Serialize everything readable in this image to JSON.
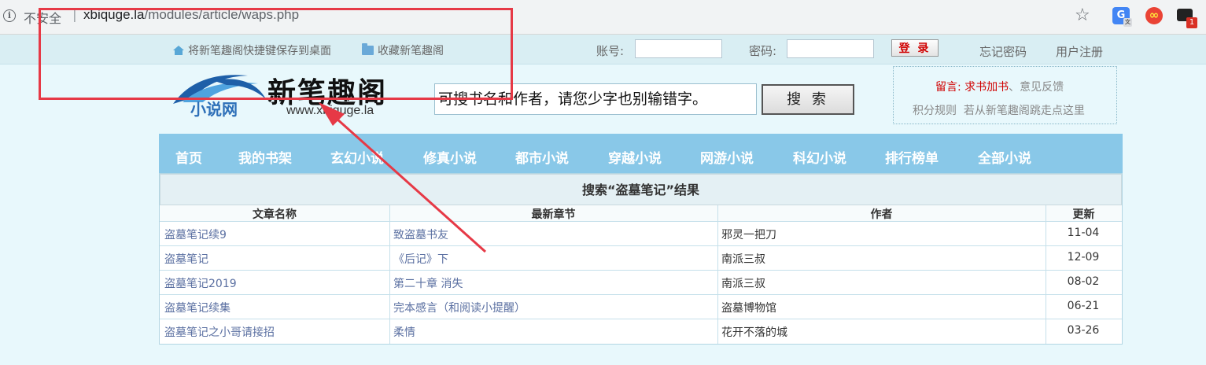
{
  "browser": {
    "insecure_label": "不安全",
    "separator": "|",
    "url_host": "xbiquge.la",
    "url_path": "/modules/article/waps.php",
    "extension_badge": "1"
  },
  "topbar": {
    "save_shortcut": "将新笔趣阁快捷键保存到桌面",
    "bookmark": "收藏新笔趣阁",
    "account_label": "账号:",
    "password_label": "密码:",
    "login_button": "登 录",
    "forgot_password": "忘记密码",
    "register": "用户注册"
  },
  "logo": {
    "title": "新笔趣阁",
    "subtitle": "小说网",
    "url": "www.xbiquge.la"
  },
  "search": {
    "placeholder": "可搜书名和作者，请您少字也别输错字。",
    "button": "搜 索"
  },
  "notice": {
    "prefix": "留言:",
    "request_book": "求书加书",
    "sep": "、",
    "feedback": "意见反馈",
    "rules": "积分规则",
    "redirect": "若从新笔趣阁跳走点这里"
  },
  "nav": {
    "items": [
      "首页",
      "我的书架",
      "玄幻小说",
      "修真小说",
      "都市小说",
      "穿越小说",
      "网游小说",
      "科幻小说",
      "排行榜单",
      "全部小说"
    ]
  },
  "results": {
    "title": "搜索“盗墓笔记”结果",
    "headers": [
      "文章名称",
      "最新章节",
      "作者",
      "更新"
    ],
    "rows": [
      {
        "name": "盗墓笔记续9",
        "chapter": "致盗墓书友",
        "author": "邪灵一把刀",
        "date": "11-04"
      },
      {
        "name": "盗墓笔记",
        "chapter": "《后记》下",
        "author": "南派三叔",
        "date": "12-09"
      },
      {
        "name": "盗墓笔记2019",
        "chapter": "第二十章 消失",
        "author": "南派三叔",
        "date": "08-02"
      },
      {
        "name": "盗墓笔记续集",
        "chapter": "完本感言（和阅读小提醒）",
        "author": "盗墓博物馆",
        "date": "06-21"
      },
      {
        "name": "盗墓笔记之小哥请接招",
        "chapter": "柔情",
        "author": "花开不落的城",
        "date": "03-26"
      }
    ]
  },
  "colors": {
    "nav_bg": "#89c8e8",
    "page_bg": "#e8f8fc",
    "link": "#5a6fa1",
    "alert_red": "#d00000",
    "annotation": "#e63946"
  }
}
